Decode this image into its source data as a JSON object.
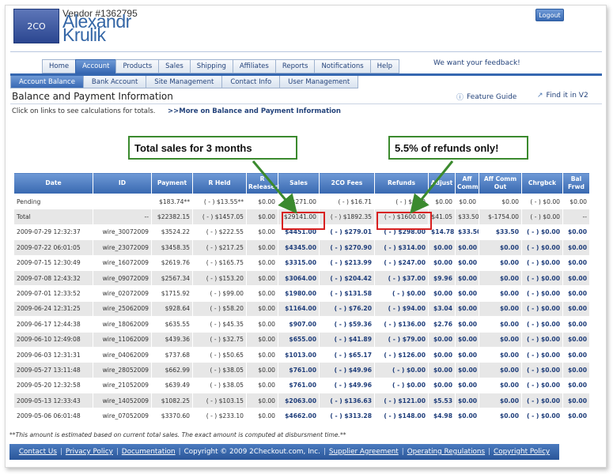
{
  "header": {
    "logo_text": "2CO",
    "vendor_id": "Vendor #1362795",
    "vendor_name": "Alexandr Krulik",
    "logout_label": "Logout",
    "feedback_text": "We want your feedback!"
  },
  "main_tabs": [
    {
      "label": "Home",
      "active": false
    },
    {
      "label": "Account",
      "active": true
    },
    {
      "label": "Products",
      "active": false
    },
    {
      "label": "Sales",
      "active": false
    },
    {
      "label": "Shipping",
      "active": false
    },
    {
      "label": "Affiliates",
      "active": false
    },
    {
      "label": "Reports",
      "active": false
    },
    {
      "label": "Notifications",
      "active": false
    },
    {
      "label": "Help",
      "active": false
    }
  ],
  "sub_tabs": [
    {
      "label": "Account Balance",
      "active": true
    },
    {
      "label": "Bank Account",
      "active": false
    },
    {
      "label": "Site Management",
      "active": false
    },
    {
      "label": "Contact Info",
      "active": false
    },
    {
      "label": "User Management",
      "active": false
    }
  ],
  "page": {
    "title": "Balance and Payment Information",
    "feature_guide": "Feature Guide",
    "find_v2": "Find it in V2",
    "hint": "Click on links to see calculations for totals.",
    "more_link": ">>More on Balance and Payment Information"
  },
  "annotations": {
    "sales": "Total sales for 3 months",
    "refunds": "5.5% of refunds only!"
  },
  "table": {
    "columns": [
      "Date",
      "ID",
      "Payment",
      "R Held",
      "R Released",
      "Sales",
      "2CO Fees",
      "Refunds",
      "Adjust",
      "Aff Comm",
      "Aff Comm Out",
      "Chrgbck",
      "Bal Frwd"
    ],
    "rows": [
      [
        "Pending",
        "",
        "$183.74**",
        "( - ) $13.55**",
        "$0.00",
        "$271.00",
        "( - ) $16.71",
        "( - ) $0.00",
        "$0.00",
        "$0.00",
        "$0.00",
        "( - ) $0.00",
        "$0.00"
      ],
      [
        "Total",
        "--",
        "$22382.15",
        "( - ) $1457.05",
        "$0.00",
        "$29141.00",
        "( - ) $1892.35",
        "( - ) $1600.00",
        "$41.05",
        "$33.50",
        "$-1754.00",
        "( - ) $0.00",
        "--"
      ],
      [
        "2009-07-29 12:32:37",
        "wire_30072009",
        "$3524.22",
        "( - ) $222.55",
        "$0.00",
        "$4451.00",
        "( - ) $279.01",
        "( - ) $298.00",
        "$14.78",
        "$33.50",
        "$33.50",
        "( - ) $0.00",
        "$0.00"
      ],
      [
        "2009-07-22 06:01:05",
        "wire_23072009",
        "$3458.35",
        "( - ) $217.25",
        "$0.00",
        "$4345.00",
        "( - ) $270.90",
        "( - ) $314.00",
        "$0.00",
        "$0.00",
        "$0.00",
        "( - ) $0.00",
        "$0.00"
      ],
      [
        "2009-07-15 12:30:49",
        "wire_16072009",
        "$2619.76",
        "( - ) $165.75",
        "$0.00",
        "$3315.00",
        "( - ) $213.99",
        "( - ) $247.00",
        "$0.00",
        "$0.00",
        "$0.00",
        "( - ) $0.00",
        "$0.00"
      ],
      [
        "2009-07-08 12:43:32",
        "wire_09072009",
        "$2567.34",
        "( - ) $153.20",
        "$0.00",
        "$3064.00",
        "( - ) $204.42",
        "( - ) $37.00",
        "$9.96",
        "$0.00",
        "$0.00",
        "( - ) $0.00",
        "$0.00"
      ],
      [
        "2009-07-01 12:33:52",
        "wire_02072009",
        "$1715.92",
        "( - ) $99.00",
        "$0.00",
        "$1980.00",
        "( - ) $131.58",
        "( - ) $0.00",
        "$0.00",
        "$0.00",
        "$0.00",
        "( - ) $0.00",
        "$0.00"
      ],
      [
        "2009-06-24 12:31:25",
        "wire_25062009",
        "$928.64",
        "( - ) $58.20",
        "$0.00",
        "$1164.00",
        "( - ) $76.20",
        "( - ) $94.00",
        "$3.04",
        "$0.00",
        "$0.00",
        "( - ) $0.00",
        "$0.00"
      ],
      [
        "2009-06-17 12:44:38",
        "wire_18062009",
        "$635.55",
        "( - ) $45.35",
        "$0.00",
        "$907.00",
        "( - ) $59.36",
        "( - ) $136.00",
        "$2.76",
        "$0.00",
        "$0.00",
        "( - ) $0.00",
        "$0.00"
      ],
      [
        "2009-06-10 12:49:08",
        "wire_11062009",
        "$439.36",
        "( - ) $32.75",
        "$0.00",
        "$655.00",
        "( - ) $41.89",
        "( - ) $79.00",
        "$0.00",
        "$0.00",
        "$0.00",
        "( - ) $0.00",
        "$0.00"
      ],
      [
        "2009-06-03 12:31:31",
        "wire_04062009",
        "$737.68",
        "( - ) $50.65",
        "$0.00",
        "$1013.00",
        "( - ) $65.17",
        "( - ) $126.00",
        "$0.00",
        "$0.00",
        "$0.00",
        "( - ) $0.00",
        "$0.00"
      ],
      [
        "2009-05-27 13:11:48",
        "wire_28052009",
        "$662.99",
        "( - ) $38.05",
        "$0.00",
        "$761.00",
        "( - ) $49.96",
        "( - ) $0.00",
        "$0.00",
        "$0.00",
        "$0.00",
        "( - ) $0.00",
        "$0.00"
      ],
      [
        "2009-05-20 12:32:58",
        "wire_21052009",
        "$639.49",
        "( - ) $38.05",
        "$0.00",
        "$761.00",
        "( - ) $49.96",
        "( - ) $0.00",
        "$0.00",
        "$0.00",
        "$0.00",
        "( - ) $0.00",
        "$0.00"
      ],
      [
        "2009-05-13 12:33:43",
        "wire_14052009",
        "$1082.25",
        "( - ) $103.15",
        "$0.00",
        "$2063.00",
        "( - ) $136.63",
        "( - ) $121.00",
        "$5.53",
        "$0.00",
        "$0.00",
        "( - ) $0.00",
        "$0.00"
      ],
      [
        "2009-05-06 06:01:48",
        "wire_07052009",
        "$3370.60",
        "( - ) $233.10",
        "$0.00",
        "$4662.00",
        "( - ) $313.28",
        "( - ) $148.00",
        "$4.98",
        "$0.00",
        "$0.00",
        "( - ) $0.00",
        "$0.00"
      ]
    ]
  },
  "footnote": "**This amount is estimated based on current total sales. The exact amount is computed at disbursment time.**",
  "footer": {
    "links": [
      "Contact Us",
      "Privacy Policy",
      "Documentation",
      "Supplier Agreement",
      "Operating Regulations",
      "Copyright Policy"
    ],
    "copyright": "Copyright © 2009 2Checkout.com, Inc."
  }
}
